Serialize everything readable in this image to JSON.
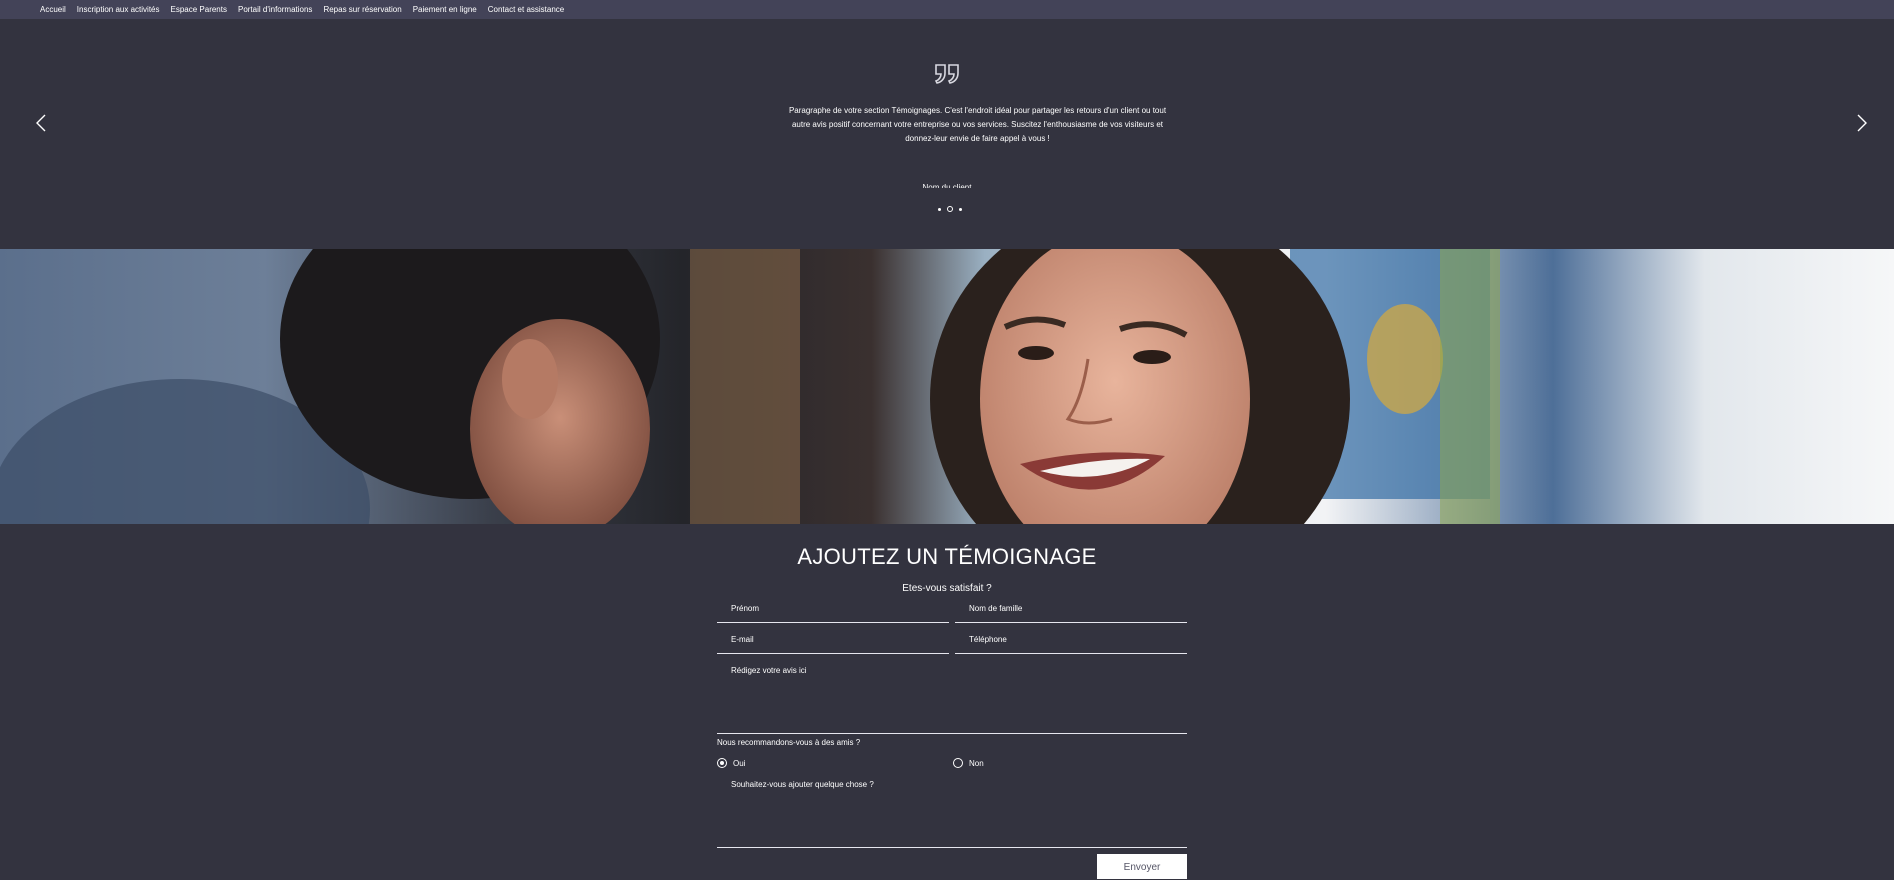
{
  "nav": {
    "items": [
      "Accueil",
      "Inscription aux activités",
      "Espace Parents",
      "Portail d'informations",
      "Repas sur réservation",
      "Paiement en ligne",
      "Contact et assistance"
    ]
  },
  "testimonial": {
    "quote_icon": "quote-icon",
    "text": "Paragraphe de votre section Témoignages. C'est l'endroit idéal pour partager les retours d'un client ou tout autre avis positif concernant votre entreprise ou vos services. Suscitez l'enthousiasme de vos visiteurs et donnez-leur envie de faire appel à vous !",
    "author": "Nom du client",
    "prev_icon": "chevron-left-icon",
    "next_icon": "chevron-right-icon",
    "dots_count": 3,
    "active_dot": 1
  },
  "form": {
    "title": "AJOUTEZ UN TÉMOIGNAGE",
    "subtitle": "Etes-vous satisfait ?",
    "first_name_placeholder": "Prénom",
    "last_name_placeholder": "Nom de famille",
    "email_placeholder": "E-mail",
    "phone_placeholder": "Téléphone",
    "review_placeholder": "Rédigez votre avis ici",
    "recommend_question": "Nous recommandons-vous à des amis ?",
    "option_yes": "Oui",
    "option_no": "Non",
    "selected_option": "Oui",
    "extra_placeholder": "Souhaitez-vous ajouter quelque chose ?",
    "submit_label": "Envoyer"
  },
  "colors": {
    "background": "#33333f",
    "nav_background": "#434358",
    "text": "#ffffff"
  }
}
